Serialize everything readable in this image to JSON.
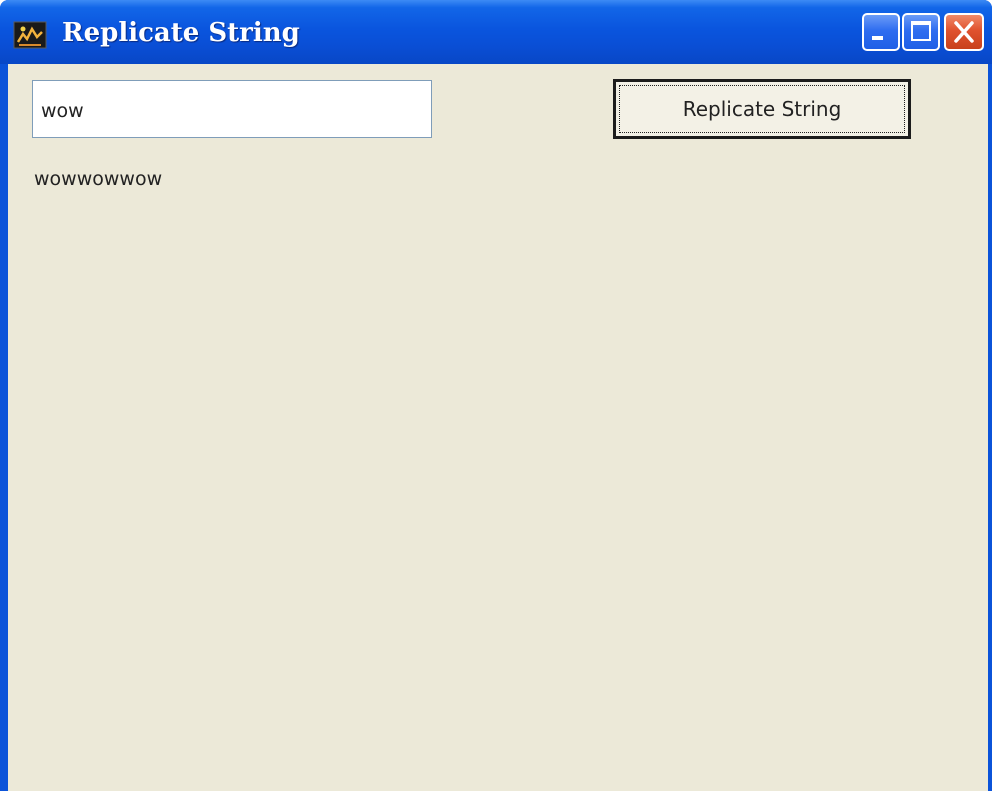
{
  "window": {
    "title": "Replicate String",
    "icon": "java-coffee-icon"
  },
  "titlebar_buttons": {
    "minimize": "minimize-icon",
    "maximize": "maximize-icon",
    "close": "close-icon"
  },
  "form": {
    "input_value": "wow",
    "button_label": "Replicate String",
    "result_text": "wowwowwow"
  },
  "colors": {
    "titlebar": "#0a55de",
    "client_background": "#ece9d8",
    "close_button": "#e0522e"
  }
}
